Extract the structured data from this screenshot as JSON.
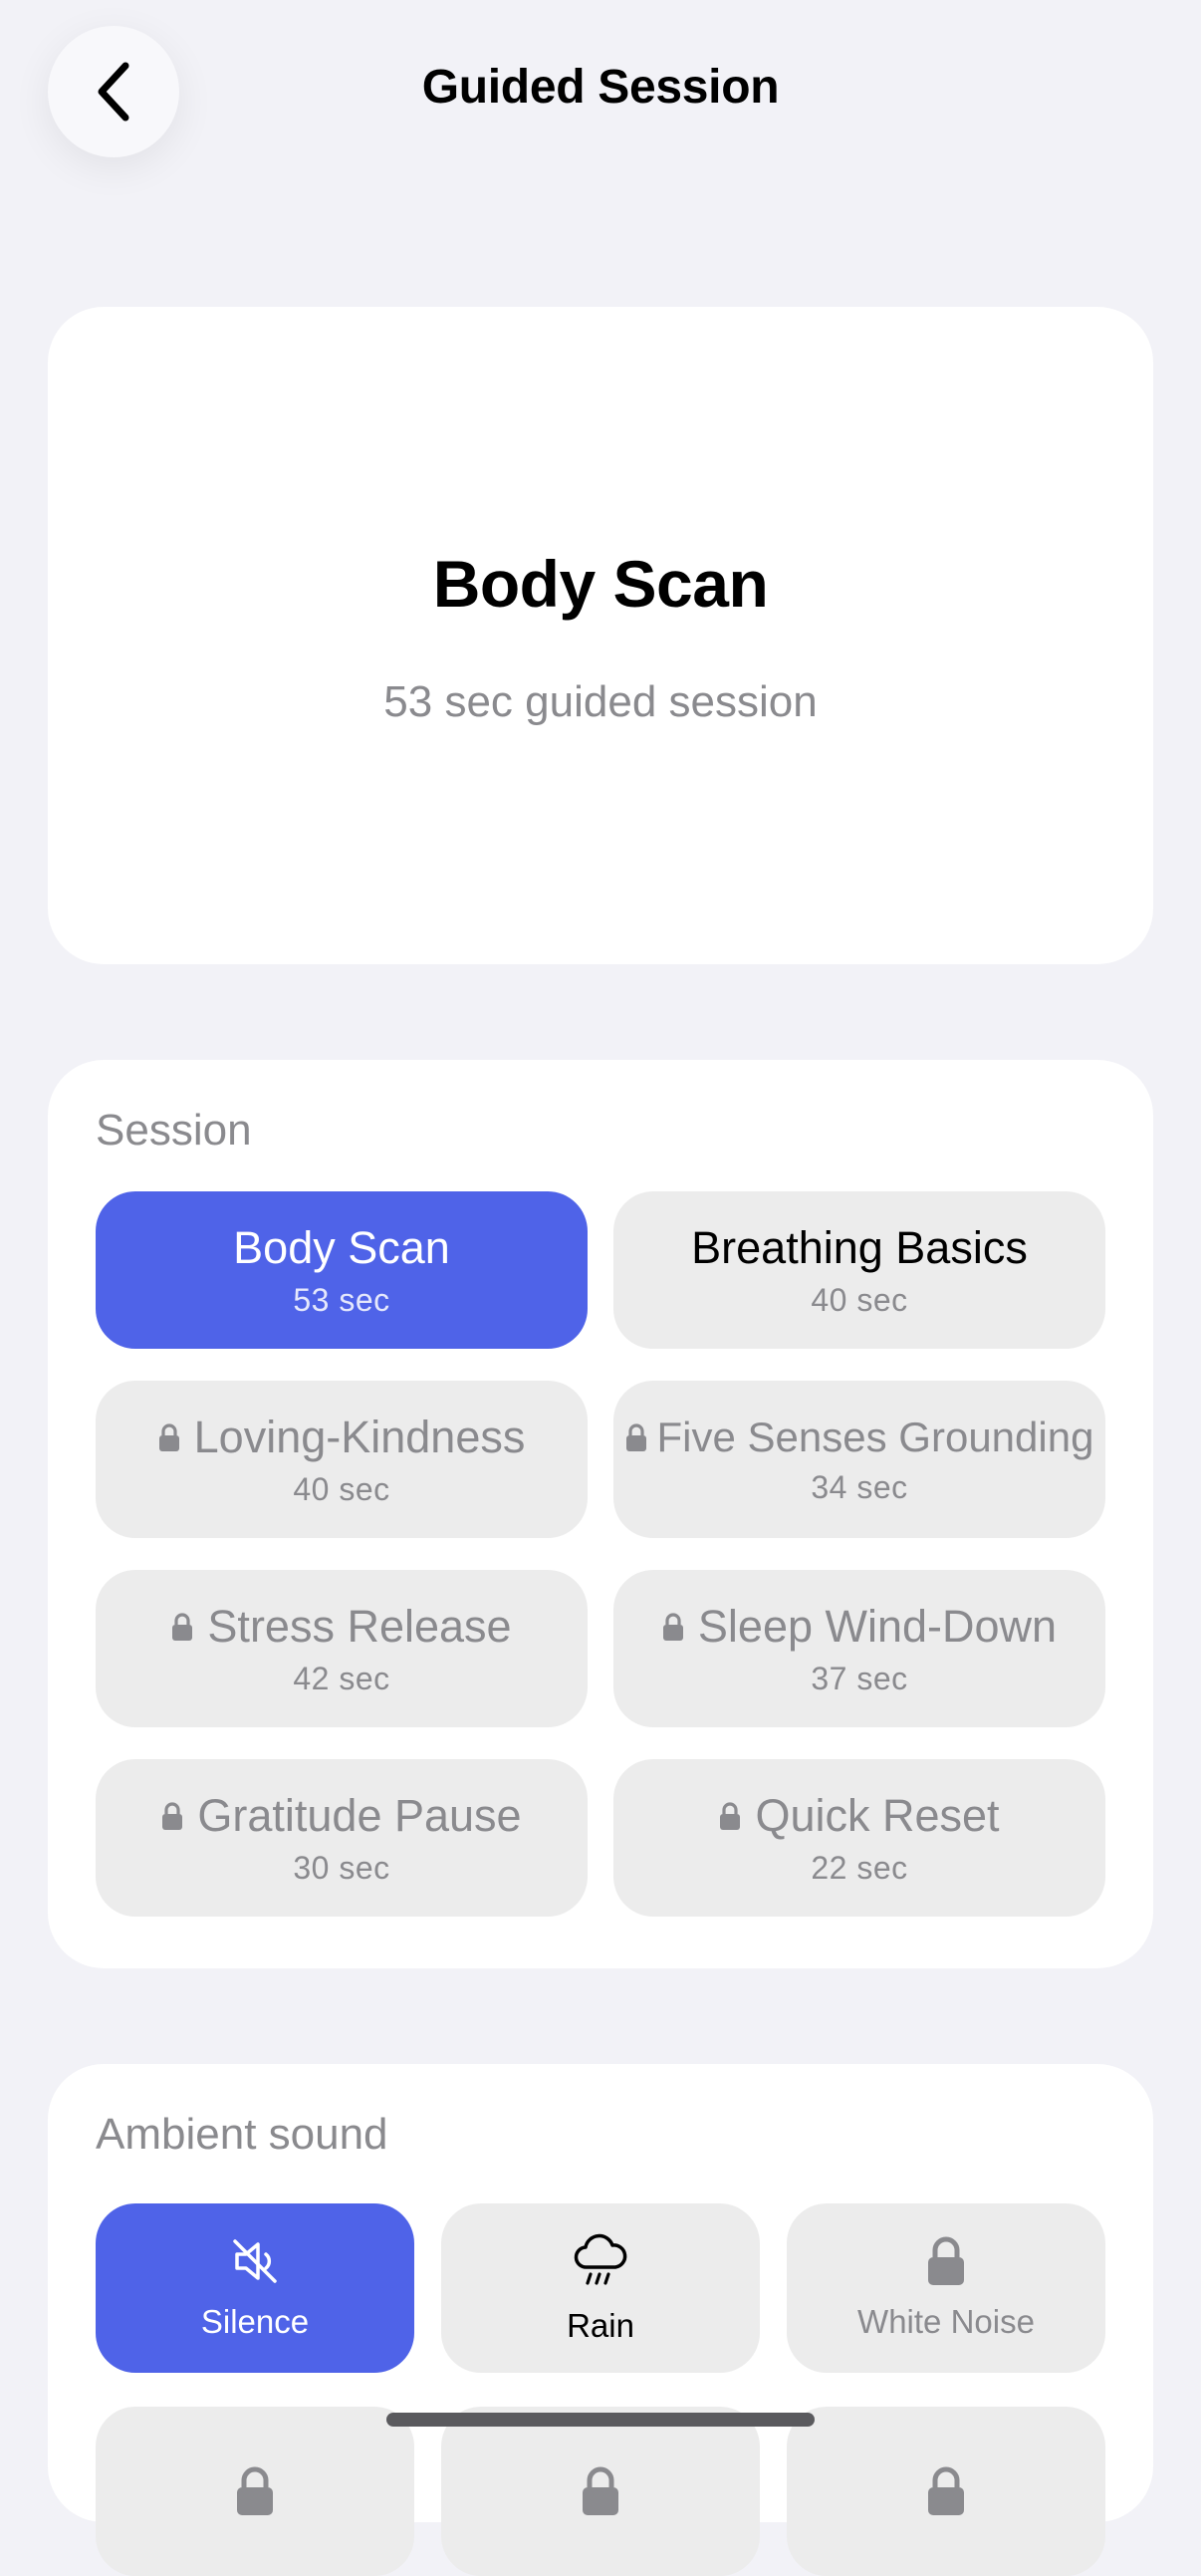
{
  "nav": {
    "title": "Guided Session",
    "back_icon": "chevron-left-icon"
  },
  "hero": {
    "title": "Body Scan",
    "subtitle": "53 sec guided session"
  },
  "session": {
    "label": "Session",
    "options": [
      {
        "title": "Body Scan",
        "duration": "53 sec",
        "state": "selected"
      },
      {
        "title": "Breathing Basics",
        "duration": "40 sec",
        "state": "open"
      },
      {
        "title": "Loving-Kindness",
        "duration": "40 sec",
        "state": "locked"
      },
      {
        "title": "Five Senses Grounding",
        "duration": "34 sec",
        "state": "locked"
      },
      {
        "title": "Stress Release",
        "duration": "42 sec",
        "state": "locked"
      },
      {
        "title": "Sleep Wind-Down",
        "duration": "37 sec",
        "state": "locked"
      },
      {
        "title": "Gratitude Pause",
        "duration": "30 sec",
        "state": "locked"
      },
      {
        "title": "Quick Reset",
        "duration": "22 sec",
        "state": "locked"
      }
    ]
  },
  "ambient": {
    "label": "Ambient sound",
    "options": [
      {
        "label": "Silence",
        "icon": "speaker-muted-icon",
        "state": "selected"
      },
      {
        "label": "Rain",
        "icon": "rain-cloud-icon",
        "state": "open"
      },
      {
        "label": "White Noise",
        "icon": "lock-icon",
        "state": "locked"
      }
    ]
  },
  "colors": {
    "accent": "#4f63e8",
    "background": "#f2f2f7",
    "muted_text": "#8a8a8e",
    "chip": "#ececec"
  }
}
